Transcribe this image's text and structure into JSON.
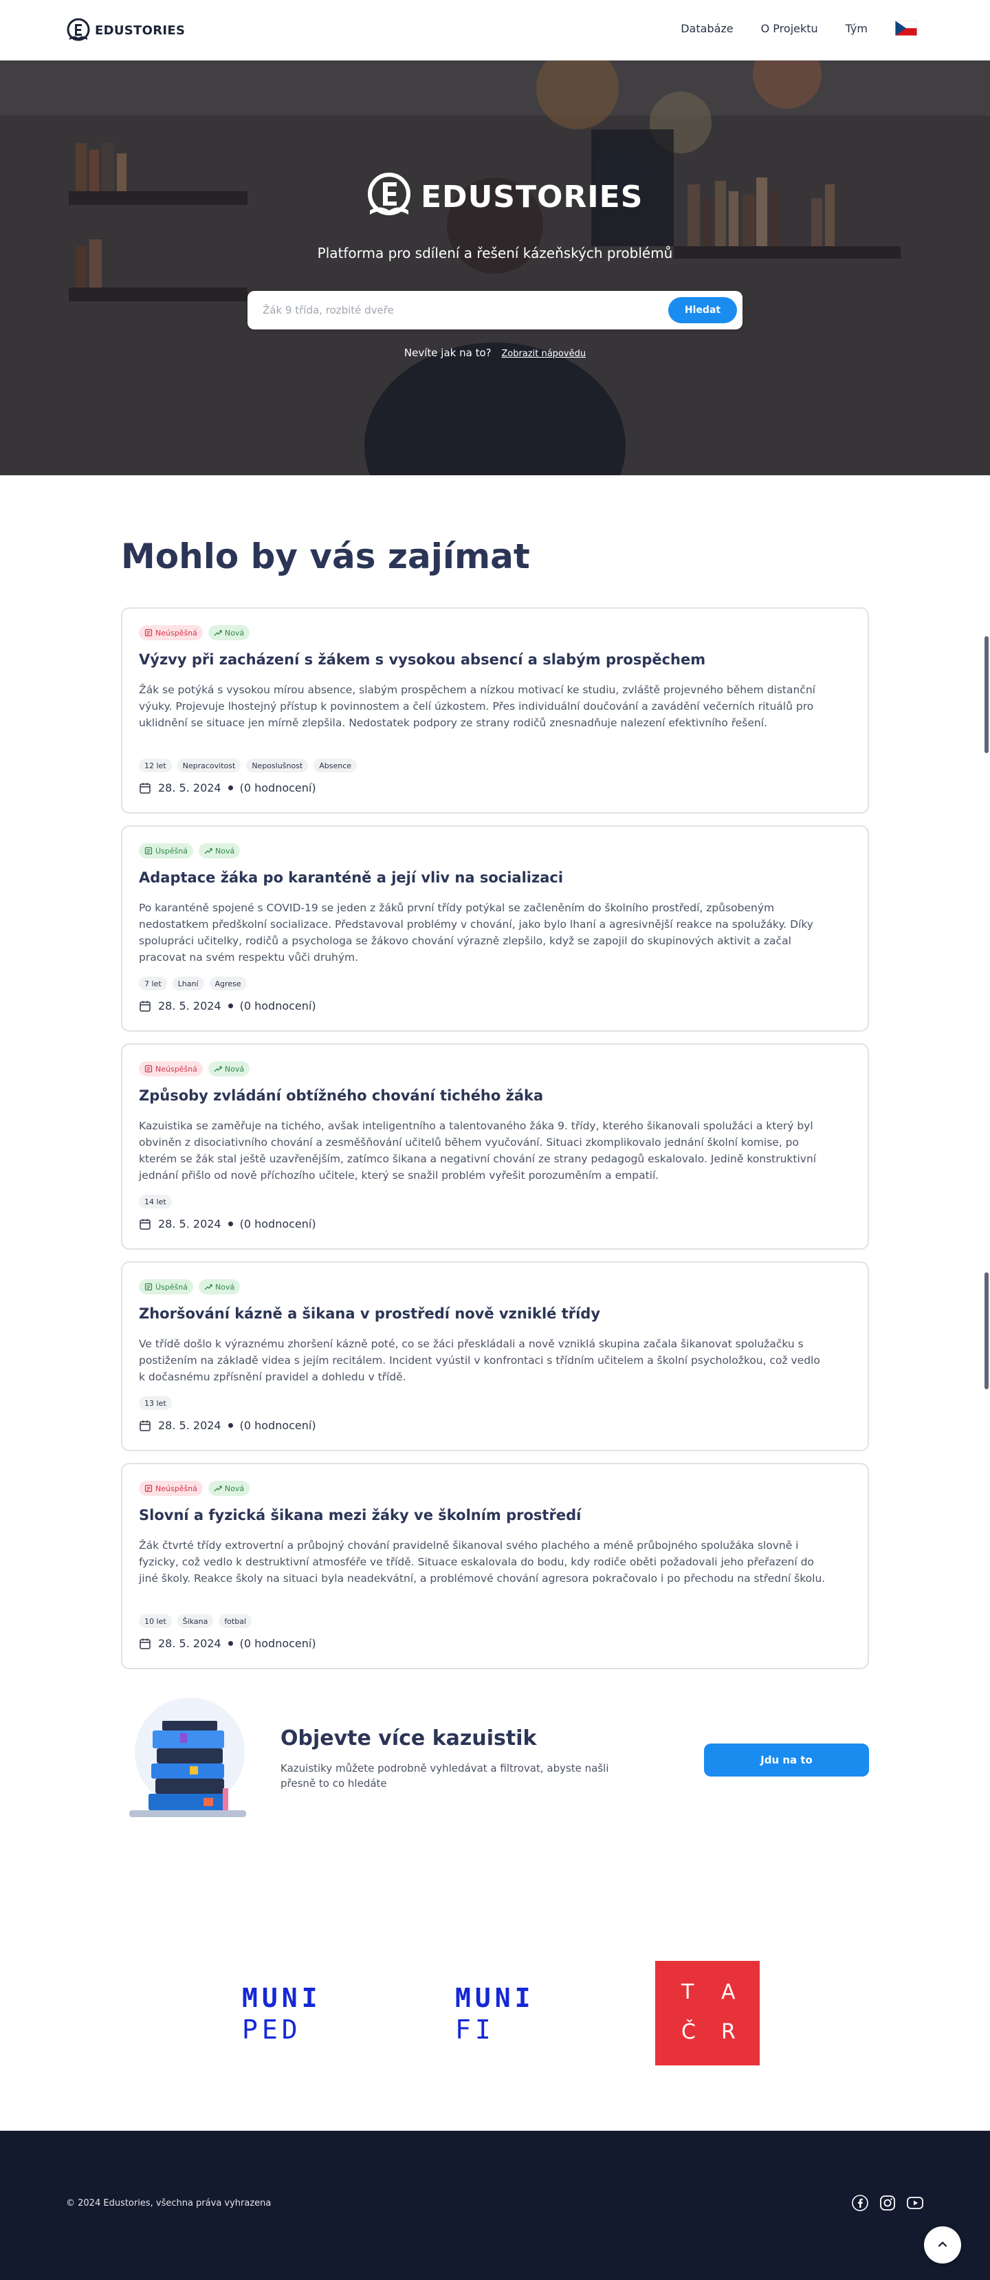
{
  "nav": {
    "brand": "EDUSTORIES",
    "links": [
      "Databáze",
      "O Projektu",
      "Tým"
    ],
    "language_flag": "czech-flag-icon"
  },
  "hero": {
    "logo_text": "EDUSTORIES",
    "tagline": "Platforma pro sdílení a řešení kázeňských problémů",
    "search_placeholder": "Žák 9 třída, rozbité dveře",
    "search_button": "Hledat",
    "help_text": "Nevíte jak na to?",
    "help_link": "Zobrazit nápovědu"
  },
  "main": {
    "title": "Mohlo by vás zajímat",
    "cards": [
      {
        "status": "Neúspěšná",
        "status_type": "fail",
        "new_label": "Nová",
        "title": "Výzvy při zacházení s žákem s vysokou absencí a slabým prospěchem",
        "description": "Žák se potýká s vysokou mírou absence, slabým prospěchem a nízkou motivací ke studiu, zvláště projevného během distanční výuky. Projevuje lhostejný přístup k povinnostem a čelí úzkostem. Přes individuální doučování a zavádění večerních rituálů pro uklidnění se situace jen mírně zlepšila. Nedostatek podpory ze strany rodičů znesnadňuje nalezení efektivního řešení.",
        "tags": [
          "12 let",
          "Nepracovitost",
          "Neposlušnost",
          "Absence"
        ],
        "date": "28. 5. 2024",
        "rating": "(0 hodnocení)"
      },
      {
        "status": "Úspěšná",
        "status_type": "ok",
        "new_label": "Nová",
        "title": "Adaptace žáka po karanténě a její vliv na socializaci",
        "description": "Po karanténě spojené s COVID-19 se jeden z žáků první třídy potýkal se začleněním do školního prostředí, způsobeným nedostatkem předškolní socializace. Představoval problémy v chování, jako bylo lhaní a agresivnější reakce na spolužáky. Díky spolupráci učitelky, rodičů a psychologa se žákovo chování výrazně zlepšilo, když se zapojil do skupinových aktivit a začal pracovat na svém respektu vůči druhým.",
        "tags": [
          "7 let",
          "Lhaní",
          "Agrese"
        ],
        "date": "28. 5. 2024",
        "rating": "(0 hodnocení)"
      },
      {
        "status": "Neúspěšná",
        "status_type": "fail",
        "new_label": "Nová",
        "title": "Způsoby zvládání obtížného chování tichého žáka",
        "description": "Kazuistika se zaměřuje na tichého, avšak inteligentního a talentovaného žáka 9. třídy, kterého šikanovali spolužáci a který byl obviněn z disociativního chování a zesměšňování učitelů během vyučování. Situaci zkomplikovalo jednání školní komise, po kterém se žák stal ještě uzavřenějším, zatímco šikana a negativní chování ze strany pedagogů eskalovalo. Jedině konstruktivní jednání přišlo od nově příchozího učitele, který se snažil problém vyřešit porozuměním a empatií.",
        "tags": [
          "14 let"
        ],
        "date": "28. 5. 2024",
        "rating": "(0 hodnocení)"
      },
      {
        "status": "Úspěšná",
        "status_type": "ok",
        "new_label": "Nová",
        "title": "Zhoršování kázně a šikana v prostředí nově vzniklé třídy",
        "description": "Ve třídě došlo k výraznému zhoršení kázně poté, co se žáci přeskládali a nově vzniklá skupina začala šikanovat spolužačku s postižením na základě videa s jejím recitálem. Incident vyústil v konfrontaci s třídním učitelem a školní psycholožkou, což vedlo k dočasnému zpřísnění pravidel a dohledu v třídě.",
        "tags": [
          "13 let"
        ],
        "date": "28. 5. 2024",
        "rating": "(0 hodnocení)"
      },
      {
        "status": "Neúspěšná",
        "status_type": "fail",
        "new_label": "Nová",
        "title": "Slovní a fyzická šikana mezi žáky ve školním prostředí",
        "description": "Žák čtvrté třídy extrovertní a průbojný chování pravidelně šikanoval svého plachého a méně průbojného spolužáka slovně i fyzicky, což vedlo k destruktivní atmosféře ve třídě. Situace eskalovala do bodu, kdy rodiče oběti požadovali jeho přeřazení do jiné školy. Reakce školy na situaci byla neadekvátní, a problémové chování agresora pokračovalo i po přechodu na střední školu.",
        "tags": [
          "10 let",
          "Šikana",
          "fotbal"
        ],
        "date": "28. 5. 2024",
        "rating": "(0 hodnocení)"
      }
    ]
  },
  "promo": {
    "title": "Objevte více kazuistik",
    "text": "Kazuistiky můžete podrobně vyhledávat a filtrovat, abyste našli přesně to co hledáte",
    "button": "Jdu na to"
  },
  "partners": {
    "muni_ped": [
      "MUNI",
      "PED"
    ],
    "muni_fi": [
      "MUNI",
      "FI"
    ],
    "tacr": [
      "T",
      "A",
      "Č",
      "R"
    ]
  },
  "footer": {
    "copyright": "© 2024 Edustories, všechna práva vyhrazena",
    "socials": [
      "facebook-icon",
      "instagram-icon",
      "youtube-icon"
    ]
  },
  "colors": {
    "accent": "#1a8cf0",
    "heading": "#2b3556",
    "footer_bg": "#131a2e",
    "fail_badge": "#d8344f",
    "ok_badge": "#2e8a45",
    "tacr_red": "#e8323a",
    "muni_blue": "#1428d6"
  }
}
